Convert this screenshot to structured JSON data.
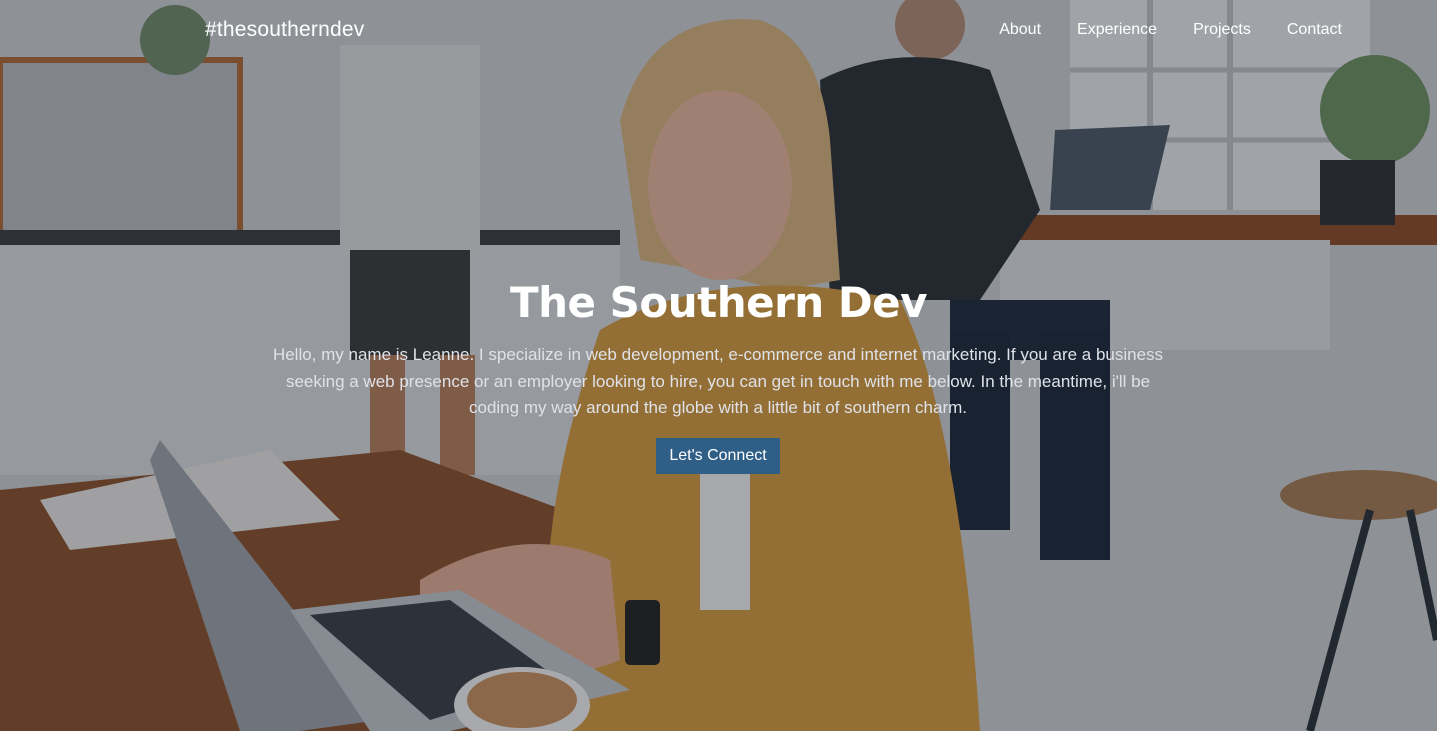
{
  "nav": {
    "brand": "#thesoutherndev",
    "items": [
      {
        "label": "About"
      },
      {
        "label": "Experience"
      },
      {
        "label": "Projects"
      },
      {
        "label": "Contact"
      }
    ]
  },
  "hero": {
    "title": "The Southern Dev",
    "intro": "Hello, my name is Leanne. I specialize in web development, e-commerce and internet marketing. If you are a business seeking a web presence or an employer looking to hire, you can get in touch with me below. In the meantime, i'll be coding my way around the globe with a little bit of southern charm.",
    "cta_label": "Let's Connect",
    "background": "photo of a woman typing on a laptop in a cafe"
  },
  "colors": {
    "accent": "#2f5f86",
    "text": "#ffffff"
  }
}
